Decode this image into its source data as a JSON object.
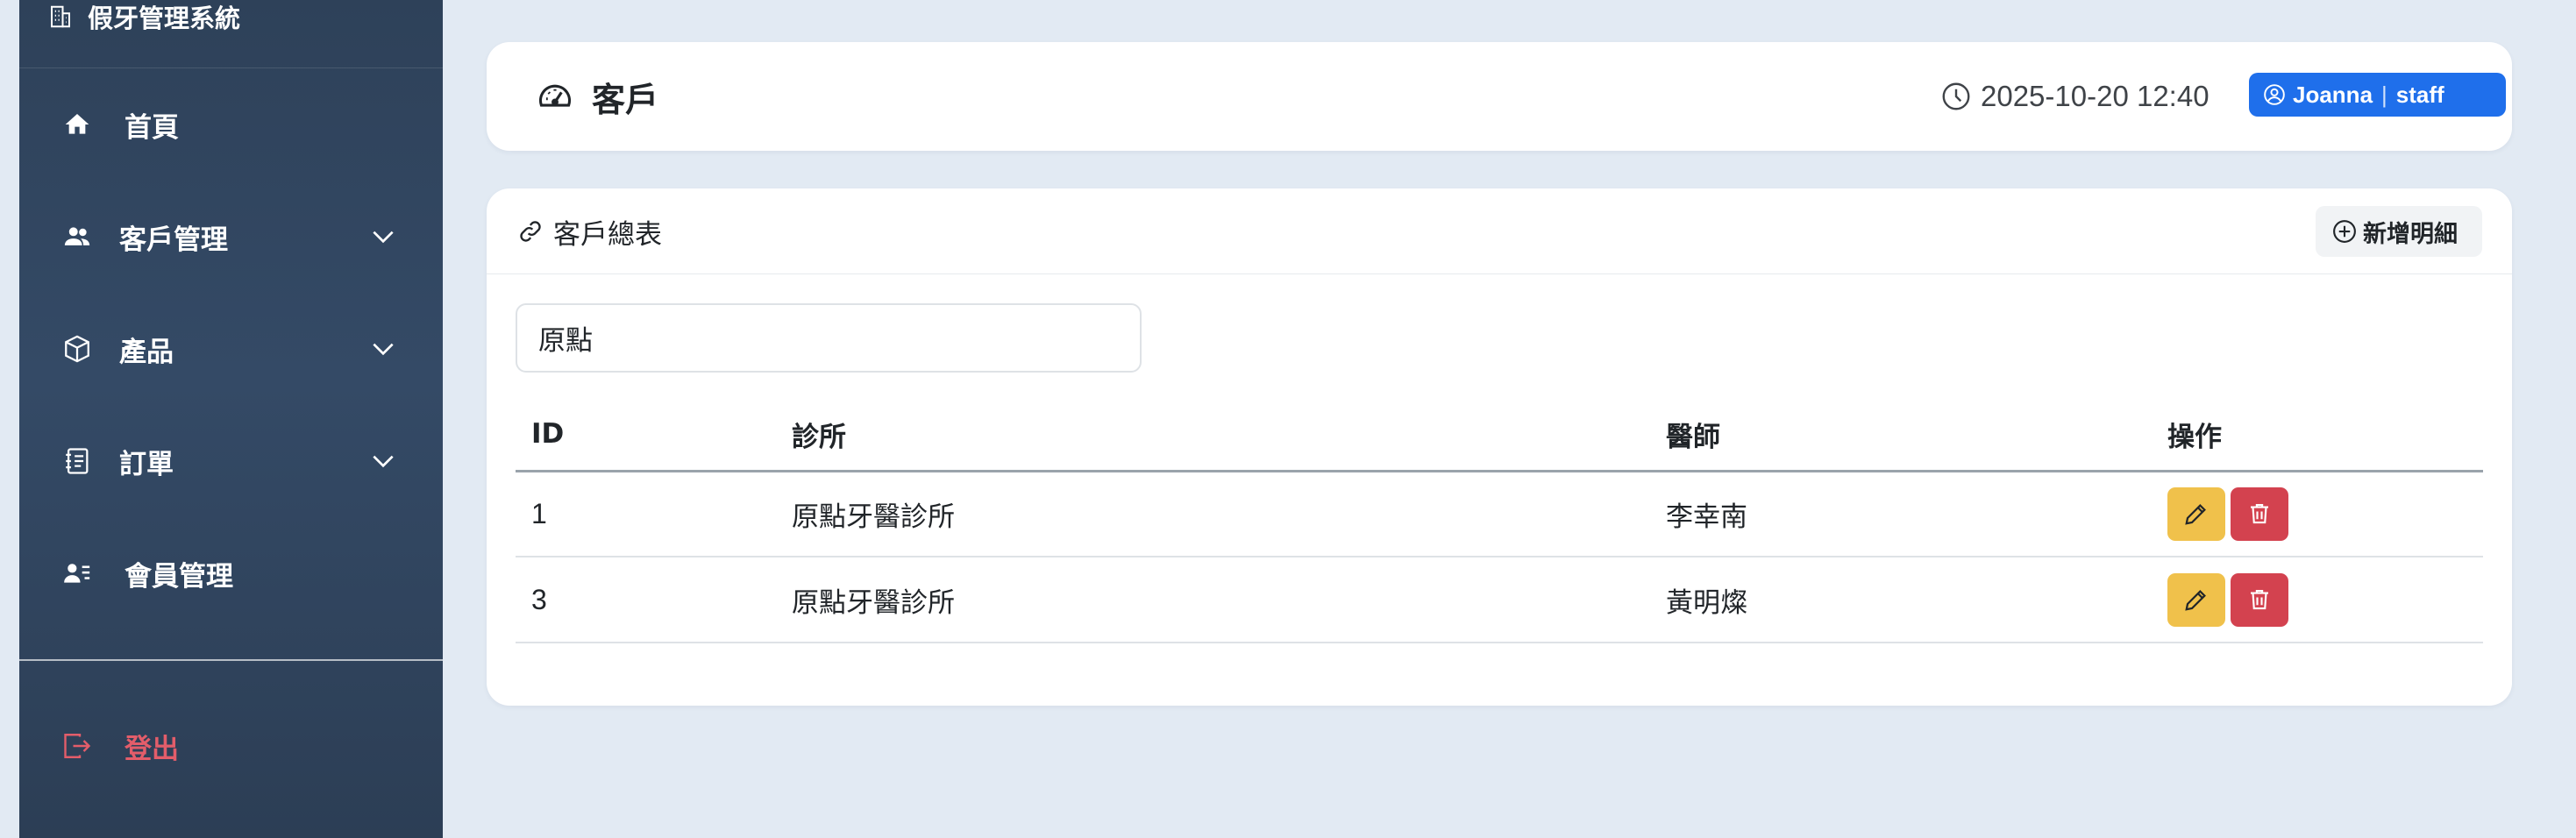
{
  "sidebar": {
    "brand": "假牙管理系統",
    "items": [
      {
        "label": "首頁",
        "icon": "home-icon"
      },
      {
        "label": "客戶管理",
        "icon": "users-icon"
      },
      {
        "label": "產品",
        "icon": "box-icon"
      },
      {
        "label": "訂單",
        "icon": "journal-icon"
      },
      {
        "label": "會員管理",
        "icon": "member-list-icon"
      }
    ],
    "logout": "登出"
  },
  "header": {
    "title": "客戶",
    "datetime": "2025-10-20 12:40",
    "user": "Joanna",
    "separator": "|",
    "role": "staff"
  },
  "main": {
    "card_title": "客戶總表",
    "add_button": "新增明細",
    "search": {
      "value": "原點",
      "placeholder": ""
    },
    "columns": [
      "ID",
      "診所",
      "醫師",
      "操作"
    ],
    "rows": [
      {
        "id": "1",
        "clinic": "原點牙醫診所",
        "doctor": "李幸南"
      },
      {
        "id": "3",
        "clinic": "原點牙醫診所",
        "doctor": "黃明燦"
      }
    ]
  },
  "colors": {
    "sidebar": "#2e4159",
    "accent": "#1f6feb",
    "edit": "#f0c14b",
    "delete": "#d3424f",
    "logout": "#e35d6a",
    "background": "#e2eaf3"
  }
}
